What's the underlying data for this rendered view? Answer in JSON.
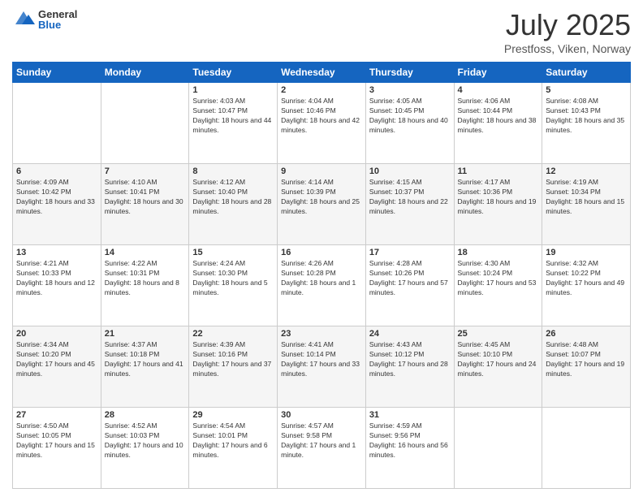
{
  "header": {
    "logo_general": "General",
    "logo_blue": "Blue",
    "month_year": "July 2025",
    "location": "Prestfoss, Viken, Norway"
  },
  "days_of_week": [
    "Sunday",
    "Monday",
    "Tuesday",
    "Wednesday",
    "Thursday",
    "Friday",
    "Saturday"
  ],
  "weeks": [
    [
      {
        "day": "",
        "info": ""
      },
      {
        "day": "",
        "info": ""
      },
      {
        "day": "1",
        "info": "Sunrise: 4:03 AM\nSunset: 10:47 PM\nDaylight: 18 hours and 44 minutes."
      },
      {
        "day": "2",
        "info": "Sunrise: 4:04 AM\nSunset: 10:46 PM\nDaylight: 18 hours and 42 minutes."
      },
      {
        "day": "3",
        "info": "Sunrise: 4:05 AM\nSunset: 10:45 PM\nDaylight: 18 hours and 40 minutes."
      },
      {
        "day": "4",
        "info": "Sunrise: 4:06 AM\nSunset: 10:44 PM\nDaylight: 18 hours and 38 minutes."
      },
      {
        "day": "5",
        "info": "Sunrise: 4:08 AM\nSunset: 10:43 PM\nDaylight: 18 hours and 35 minutes."
      }
    ],
    [
      {
        "day": "6",
        "info": "Sunrise: 4:09 AM\nSunset: 10:42 PM\nDaylight: 18 hours and 33 minutes."
      },
      {
        "day": "7",
        "info": "Sunrise: 4:10 AM\nSunset: 10:41 PM\nDaylight: 18 hours and 30 minutes."
      },
      {
        "day": "8",
        "info": "Sunrise: 4:12 AM\nSunset: 10:40 PM\nDaylight: 18 hours and 28 minutes."
      },
      {
        "day": "9",
        "info": "Sunrise: 4:14 AM\nSunset: 10:39 PM\nDaylight: 18 hours and 25 minutes."
      },
      {
        "day": "10",
        "info": "Sunrise: 4:15 AM\nSunset: 10:37 PM\nDaylight: 18 hours and 22 minutes."
      },
      {
        "day": "11",
        "info": "Sunrise: 4:17 AM\nSunset: 10:36 PM\nDaylight: 18 hours and 19 minutes."
      },
      {
        "day": "12",
        "info": "Sunrise: 4:19 AM\nSunset: 10:34 PM\nDaylight: 18 hours and 15 minutes."
      }
    ],
    [
      {
        "day": "13",
        "info": "Sunrise: 4:21 AM\nSunset: 10:33 PM\nDaylight: 18 hours and 12 minutes."
      },
      {
        "day": "14",
        "info": "Sunrise: 4:22 AM\nSunset: 10:31 PM\nDaylight: 18 hours and 8 minutes."
      },
      {
        "day": "15",
        "info": "Sunrise: 4:24 AM\nSunset: 10:30 PM\nDaylight: 18 hours and 5 minutes."
      },
      {
        "day": "16",
        "info": "Sunrise: 4:26 AM\nSunset: 10:28 PM\nDaylight: 18 hours and 1 minute."
      },
      {
        "day": "17",
        "info": "Sunrise: 4:28 AM\nSunset: 10:26 PM\nDaylight: 17 hours and 57 minutes."
      },
      {
        "day": "18",
        "info": "Sunrise: 4:30 AM\nSunset: 10:24 PM\nDaylight: 17 hours and 53 minutes."
      },
      {
        "day": "19",
        "info": "Sunrise: 4:32 AM\nSunset: 10:22 PM\nDaylight: 17 hours and 49 minutes."
      }
    ],
    [
      {
        "day": "20",
        "info": "Sunrise: 4:34 AM\nSunset: 10:20 PM\nDaylight: 17 hours and 45 minutes."
      },
      {
        "day": "21",
        "info": "Sunrise: 4:37 AM\nSunset: 10:18 PM\nDaylight: 17 hours and 41 minutes."
      },
      {
        "day": "22",
        "info": "Sunrise: 4:39 AM\nSunset: 10:16 PM\nDaylight: 17 hours and 37 minutes."
      },
      {
        "day": "23",
        "info": "Sunrise: 4:41 AM\nSunset: 10:14 PM\nDaylight: 17 hours and 33 minutes."
      },
      {
        "day": "24",
        "info": "Sunrise: 4:43 AM\nSunset: 10:12 PM\nDaylight: 17 hours and 28 minutes."
      },
      {
        "day": "25",
        "info": "Sunrise: 4:45 AM\nSunset: 10:10 PM\nDaylight: 17 hours and 24 minutes."
      },
      {
        "day": "26",
        "info": "Sunrise: 4:48 AM\nSunset: 10:07 PM\nDaylight: 17 hours and 19 minutes."
      }
    ],
    [
      {
        "day": "27",
        "info": "Sunrise: 4:50 AM\nSunset: 10:05 PM\nDaylight: 17 hours and 15 minutes."
      },
      {
        "day": "28",
        "info": "Sunrise: 4:52 AM\nSunset: 10:03 PM\nDaylight: 17 hours and 10 minutes."
      },
      {
        "day": "29",
        "info": "Sunrise: 4:54 AM\nSunset: 10:01 PM\nDaylight: 17 hours and 6 minutes."
      },
      {
        "day": "30",
        "info": "Sunrise: 4:57 AM\nSunset: 9:58 PM\nDaylight: 17 hours and 1 minute."
      },
      {
        "day": "31",
        "info": "Sunrise: 4:59 AM\nSunset: 9:56 PM\nDaylight: 16 hours and 56 minutes."
      },
      {
        "day": "",
        "info": ""
      },
      {
        "day": "",
        "info": ""
      }
    ]
  ]
}
